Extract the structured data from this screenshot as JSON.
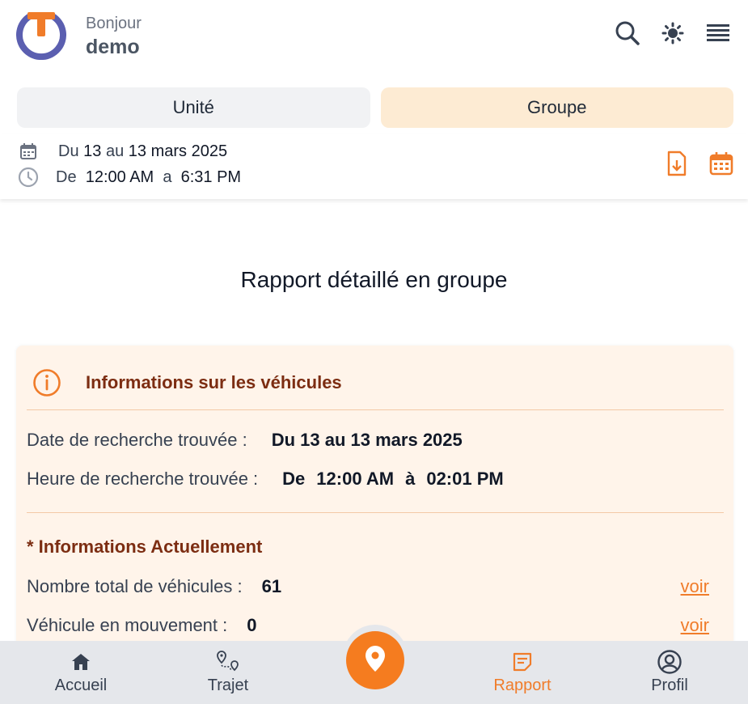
{
  "header": {
    "greeting": "Bonjour",
    "username": "demo",
    "icons": [
      "search-icon",
      "brightness-icon",
      "menu-icon"
    ]
  },
  "tabs": [
    {
      "label": "Unité",
      "active": false
    },
    {
      "label": "Groupe",
      "active": true
    }
  ],
  "filter": {
    "date_prefix": "Du",
    "date_from": "13",
    "date_mid": "au",
    "date_to": "13 mars 2025",
    "time_prefix": "De",
    "time_from": "12:00 AM",
    "time_mid": "a",
    "time_to": "6:31 PM"
  },
  "page_title": "Rapport détaillé en groupe",
  "card": {
    "title": "Informations sur les véhicules",
    "date_label": "Date de recherche trouvée :",
    "date_value": "Du 13 au 13 mars 2025",
    "time_label": "Heure de recherche trouvée :",
    "time_de": "De",
    "time_from": "12:00 AM",
    "time_a": "à",
    "time_to": "02:01 PM",
    "section_title": "* Informations Actuellement",
    "rows": [
      {
        "label": "Nombre total de véhicules :",
        "value": "61",
        "link": "voir"
      },
      {
        "label": "Véhicule en mouvement :",
        "value": "0",
        "link": "voir"
      }
    ]
  },
  "nav": {
    "items": [
      {
        "label": "Accueil",
        "icon": "home-icon"
      },
      {
        "label": "Trajet",
        "icon": "route-icon"
      },
      {
        "label": "Rapport",
        "icon": "report-icon",
        "active": true
      },
      {
        "label": "Profil",
        "icon": "profile-icon"
      }
    ],
    "fab_icon": "map-pin-icon"
  },
  "colors": {
    "accent": "#f57c1f",
    "card_bg": "#fff4ea",
    "tab_active_bg": "#fdebd3",
    "heading_brown": "#7c2d12"
  }
}
